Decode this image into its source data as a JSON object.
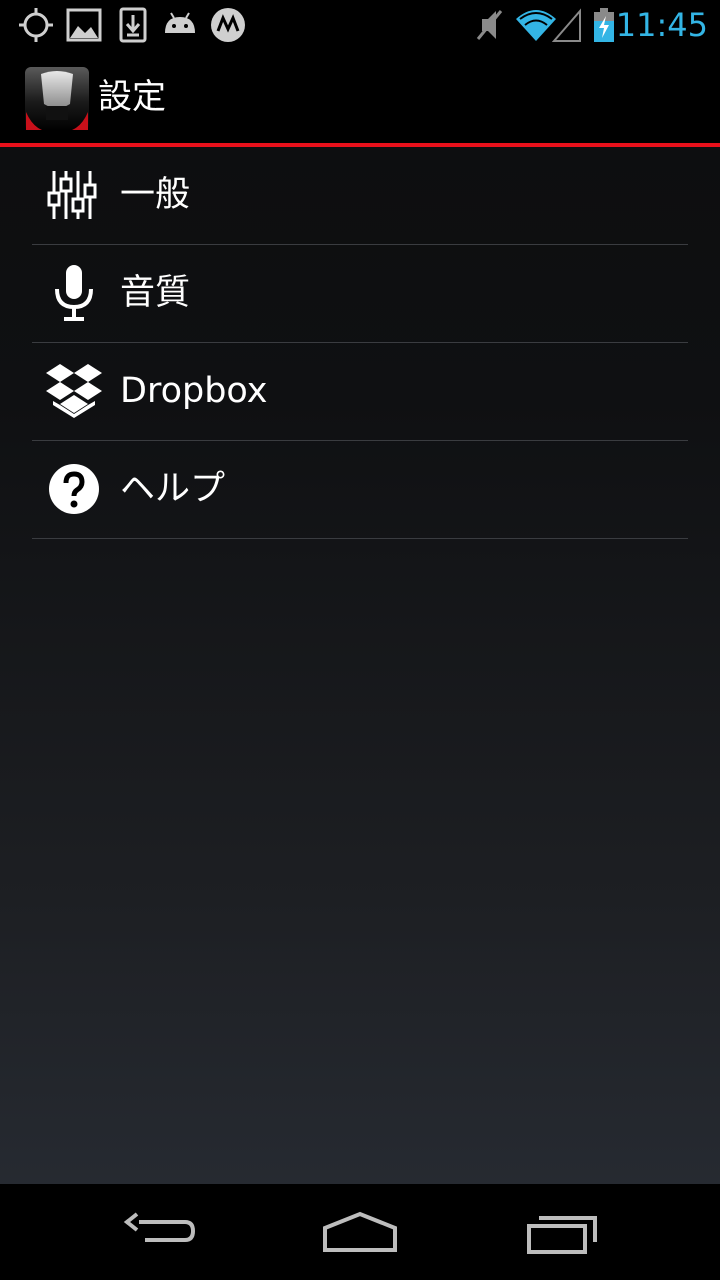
{
  "status_bar": {
    "time": "11:45",
    "accent_color": "#33b5e5",
    "left_icons": [
      "gps-icon",
      "gallery-icon",
      "download-icon",
      "android-icon",
      "motorola-icon"
    ],
    "right_icons": [
      "mute-icon",
      "wifi-icon",
      "signal-icon",
      "battery-charging-icon"
    ]
  },
  "action_bar": {
    "title": "設定",
    "app_icon": "microphone-app-icon",
    "accent_color": "#e8101b"
  },
  "settings": {
    "items": [
      {
        "label": "一般",
        "icon": "sliders-icon"
      },
      {
        "label": "音質",
        "icon": "microphone-icon"
      },
      {
        "label": "Dropbox",
        "icon": "dropbox-icon"
      },
      {
        "label": "ヘルプ",
        "icon": "help-icon"
      }
    ]
  },
  "nav_bar": {
    "buttons": [
      "back-icon",
      "home-icon",
      "recent-apps-icon"
    ]
  }
}
